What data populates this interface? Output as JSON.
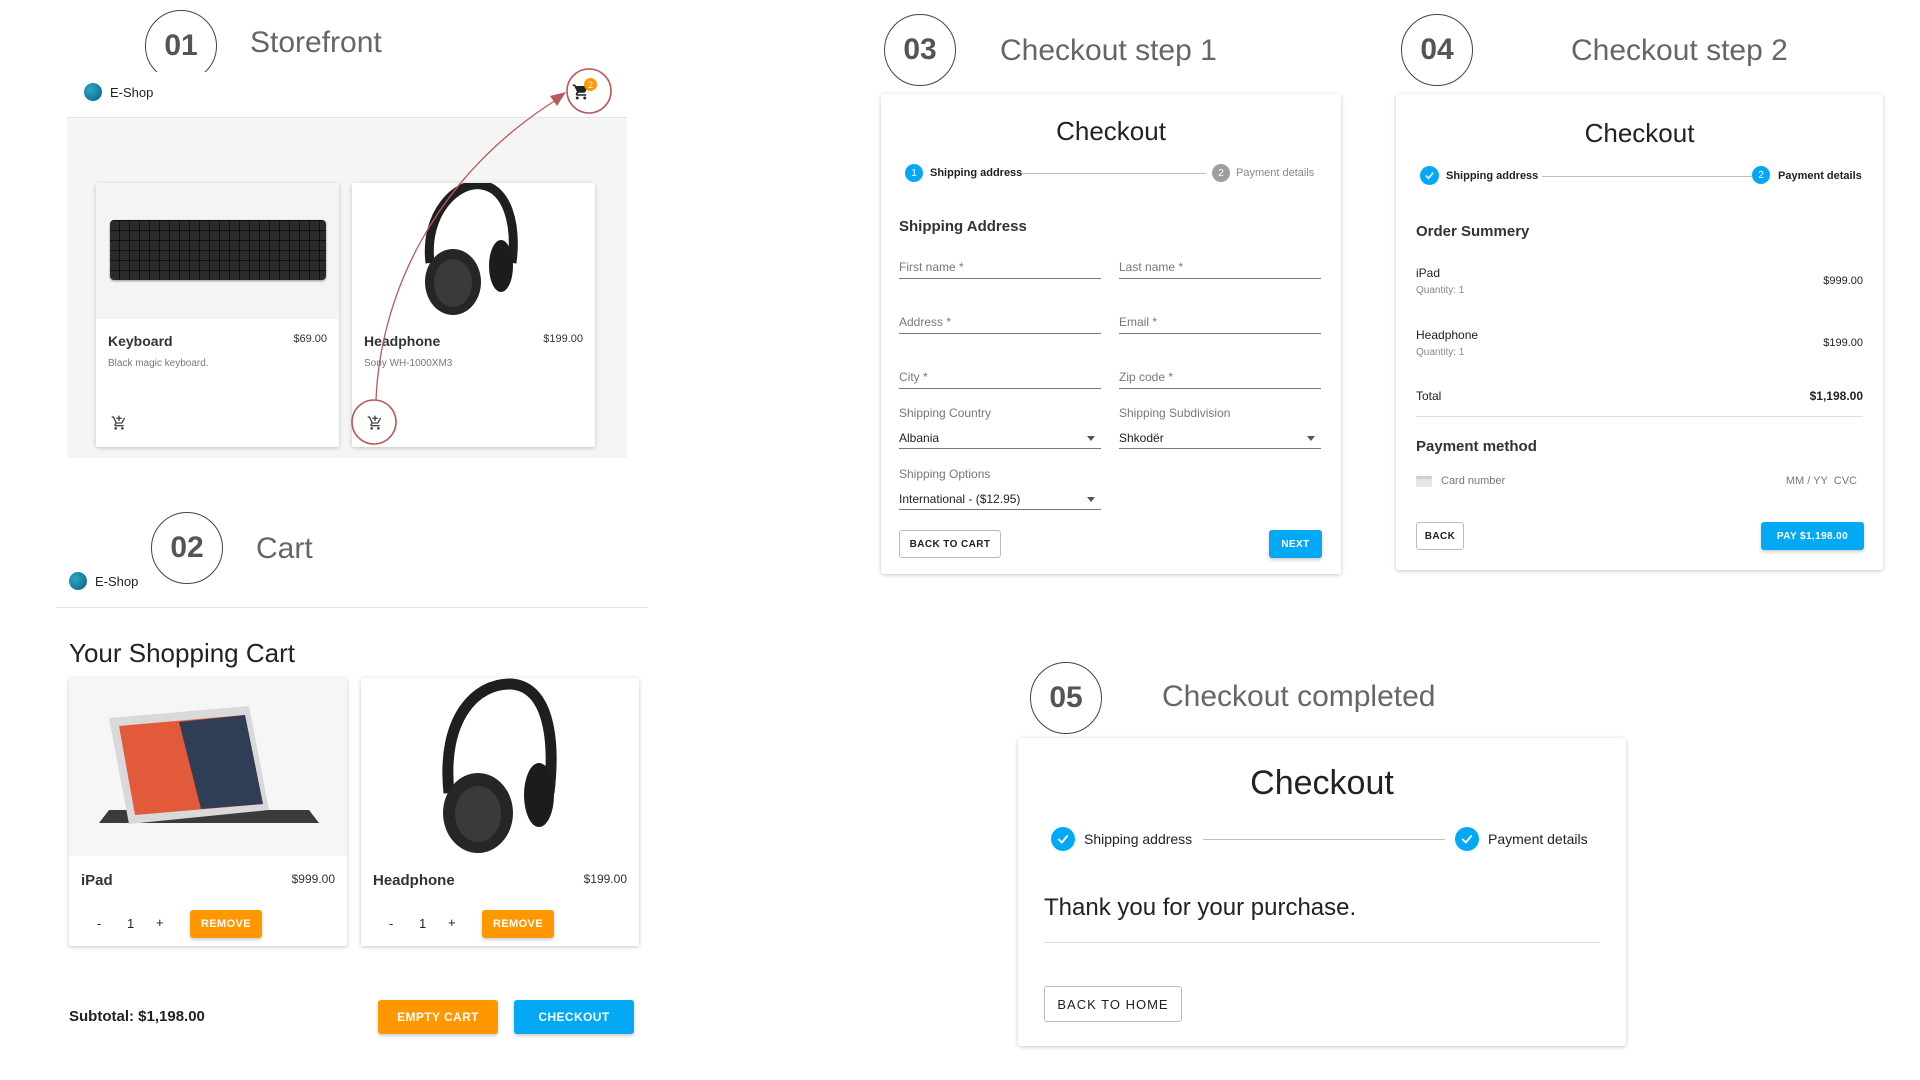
{
  "steps": [
    {
      "num": "01",
      "title": "Storefront"
    },
    {
      "num": "02",
      "title": "Cart"
    },
    {
      "num": "03",
      "title": "Checkout step 1"
    },
    {
      "num": "04",
      "title": "Checkout step 2"
    },
    {
      "num": "05",
      "title": "Checkout completed"
    }
  ],
  "brand": "E-Shop",
  "storefront": {
    "cart_badge": "2",
    "products": [
      {
        "name": "Keyboard",
        "price": "$69.00",
        "description": "Black magic keyboard."
      },
      {
        "name": "Headphone",
        "price": "$199.00",
        "description": "Sony WH-1000XM3"
      }
    ]
  },
  "cart": {
    "heading": "Your Shopping Cart",
    "items": [
      {
        "name": "iPad",
        "price": "$999.00",
        "qty": "1",
        "minus": "-",
        "plus": "+",
        "remove": "REMOVE"
      },
      {
        "name": "Headphone",
        "price": "$199.00",
        "qty": "1",
        "minus": "-",
        "plus": "+",
        "remove": "REMOVE"
      }
    ],
    "subtotal": "Subtotal: $1,198.00",
    "empty_cart": "EMPTY CART",
    "checkout": "CHECKOUT"
  },
  "checkout1": {
    "title": "Checkout",
    "step1": {
      "num": "1",
      "label": "Shipping address"
    },
    "step2": {
      "num": "2",
      "label": "Payment details"
    },
    "section": "Shipping Address",
    "fields": {
      "first_name": "First name *",
      "last_name": "Last name *",
      "address": "Address *",
      "email": "Email *",
      "city": "City *",
      "zip": "Zip code *",
      "country_label": "Shipping Country",
      "country_value": "Albania",
      "subdivision_label": "Shipping Subdivision",
      "subdivision_value": "Shkodër",
      "options_label": "Shipping Options",
      "options_value": "International - ($12.95)"
    },
    "back": "BACK TO CART",
    "next": "NEXT"
  },
  "checkout2": {
    "title": "Checkout",
    "step1": {
      "label": "Shipping address"
    },
    "step2": {
      "num": "2",
      "label": "Payment details"
    },
    "summary_title": "Order Summery",
    "items": [
      {
        "name": "iPad",
        "qty": "Quantity: 1",
        "price": "$999.00"
      },
      {
        "name": "Headphone",
        "qty": "Quantity: 1",
        "price": "$199.00"
      }
    ],
    "total_label": "Total",
    "total_value": "$1,198.00",
    "payment_title": "Payment method",
    "card_placeholder": "Card number",
    "card_extra": "MM / YY  CVC",
    "back": "BACK",
    "pay": "PAY $1,198.00"
  },
  "complete": {
    "title": "Checkout",
    "step1": {
      "label": "Shipping address"
    },
    "step2": {
      "label": "Payment details"
    },
    "message": "Thank you for your purchase.",
    "back_home": "BACK TO HOME"
  },
  "colors": {
    "accent_blue": "#03a9f4",
    "accent_orange": "#ff9800",
    "annotation_red": "#b85a5a"
  }
}
